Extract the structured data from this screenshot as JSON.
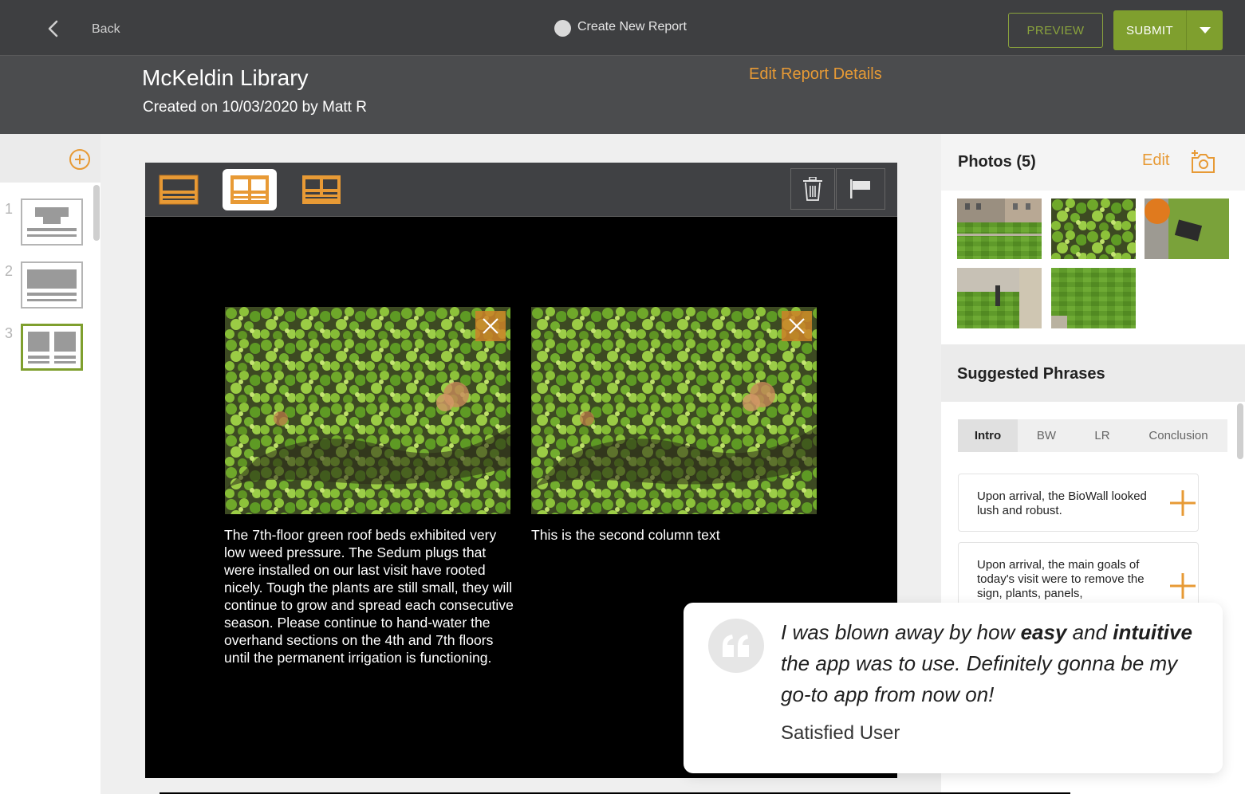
{
  "topbar": {
    "back_label": "Back",
    "title": "Create New Report",
    "preview_label": "PREVIEW",
    "submit_label": "SUBMIT"
  },
  "header": {
    "title": "McKeldin Library",
    "subtitle": "Created on 10/03/2020 by Matt R",
    "edit_link": "Edit Report Details"
  },
  "pages": [
    {
      "number": "1",
      "layout": "title"
    },
    {
      "number": "2",
      "layout": "single"
    },
    {
      "number": "3",
      "layout": "two-column",
      "selected": true
    }
  ],
  "editor": {
    "layouts": [
      "full-width",
      "two-column",
      "two-column-alt"
    ],
    "selected_layout": "two-column",
    "columns": [
      {
        "text": "The 7th-floor green roof beds exhibited very low weed pressure. The Sedum plugs that were installed on our last visit have rooted nicely. Tough the plants are still small, they will continue to grow and spread each consecutive season. Please continue to hand-water the overhand sections on the 4th and 7th floors until the permanent irrigation is functioning."
      },
      {
        "text": "This is the second column text"
      }
    ]
  },
  "photos": {
    "title": "Photos (5)",
    "edit_label": "Edit"
  },
  "phrases": {
    "title": "Suggested Phrases",
    "tabs": [
      "Intro",
      "BW",
      "LR",
      "Conclusion"
    ],
    "active_tab": "Intro",
    "items": [
      {
        "text": "Upon arrival, the BioWall looked lush and robust."
      },
      {
        "text": "Upon arrival, the main goals of today's visit were to remove the sign, plants, panels,"
      }
    ]
  },
  "testimonial": {
    "part1": "I was blown away by how ",
    "bold1": "easy",
    "part2": " and ",
    "bold2": "intuitive",
    "part3": " the app was to use. Definitely gonna be my go-to app from now on!",
    "author": "Satisfied User"
  },
  "colors": {
    "accent_orange": "#e79a35",
    "accent_green": "#7f9f2e",
    "topbar": "#3e3f41",
    "header": "#4b4c4e"
  }
}
